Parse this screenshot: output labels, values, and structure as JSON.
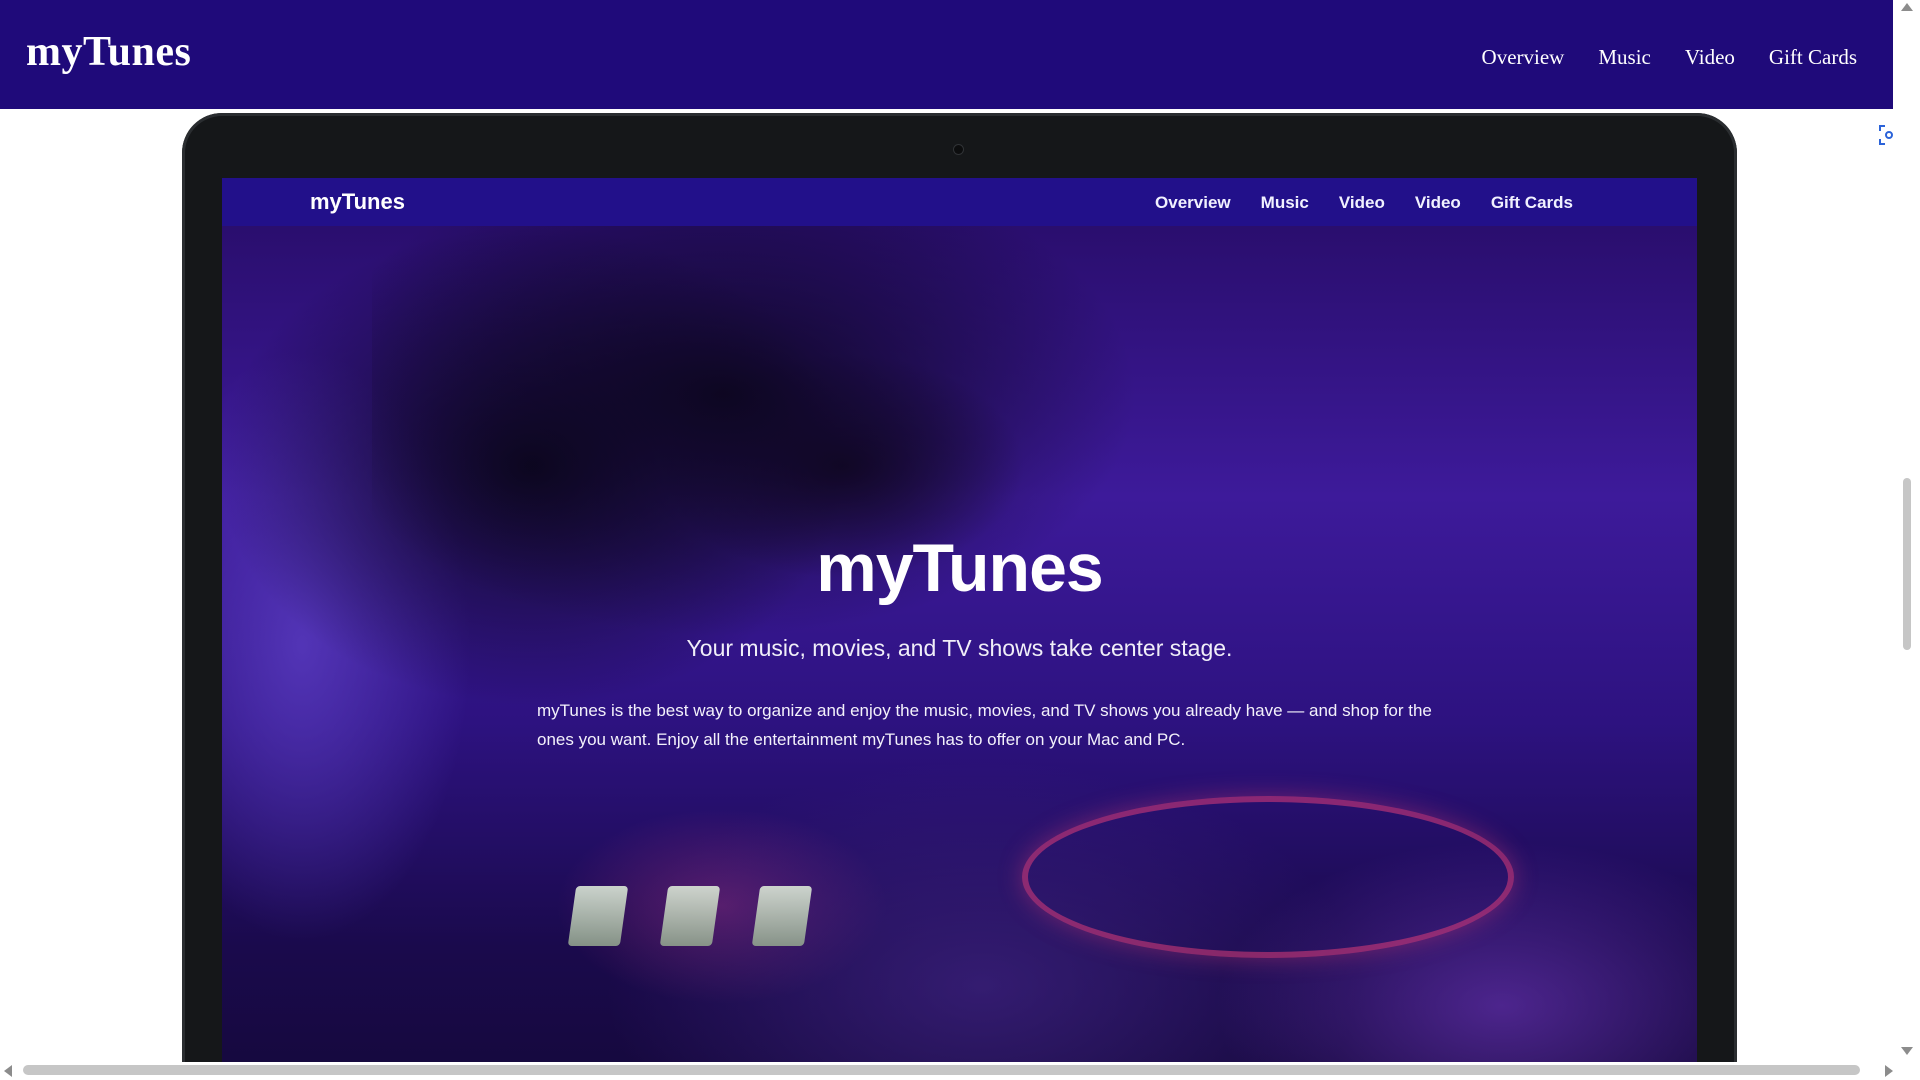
{
  "header": {
    "brand": "myTunes",
    "nav": [
      "Overview",
      "Music",
      "Video",
      "Gift Cards"
    ]
  },
  "laptop": {
    "nav": {
      "brand": "myTunes",
      "links": [
        "Overview",
        "Music",
        "Video",
        "Video",
        "Gift Cards"
      ]
    },
    "hero": {
      "title": "myTunes",
      "subtitle": "Your music, movies, and TV shows take center stage.",
      "body": "myTunes is the best way to organize and enjoy the music, movies, and TV shows you already have — and shop for the ones you want. Enjoy all the entertainment myTunes has to offer on your Mac and PC."
    }
  },
  "icons": {
    "focus": "screenshot-focus-icon"
  },
  "colors": {
    "nav_bg": "#1f0a7a",
    "inner_nav_bg": "#22108a",
    "laptop_frame": "#151719"
  },
  "scroll": {
    "vertical_position": 0.45,
    "horizontal_position": 0.0
  }
}
